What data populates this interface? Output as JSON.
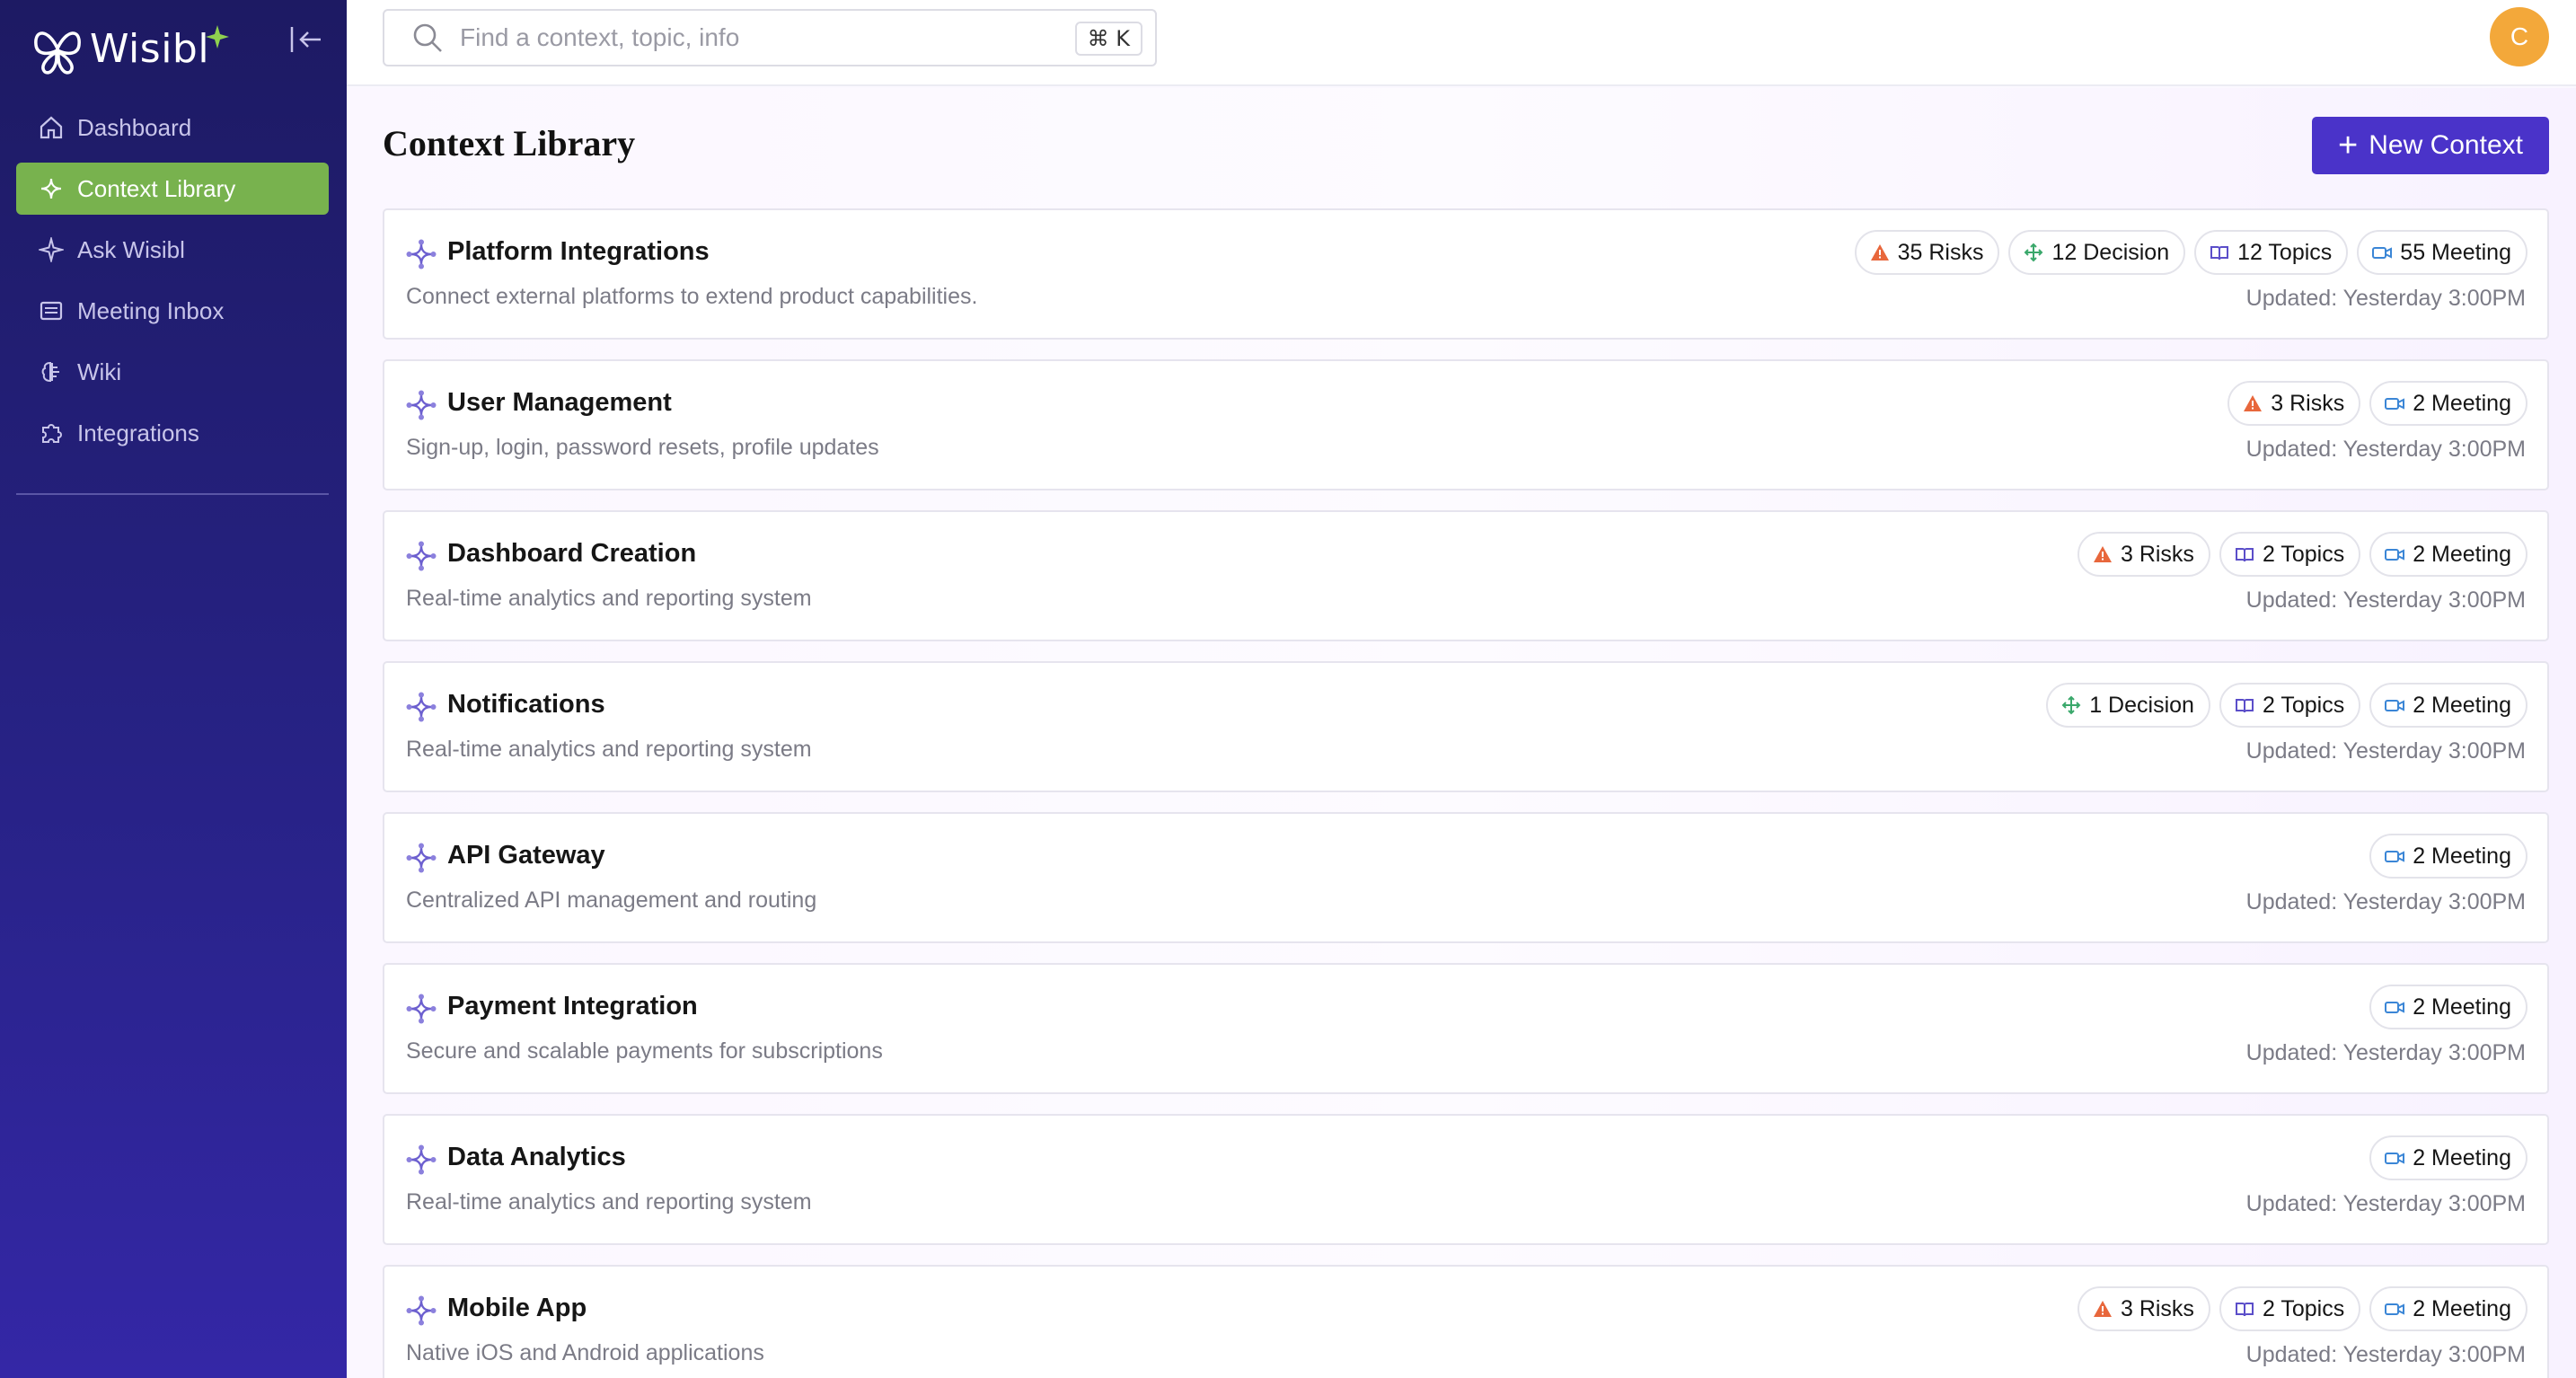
{
  "app": {
    "logo_text": "Wisibl"
  },
  "sidebar": {
    "items": [
      {
        "label": "Dashboard",
        "icon": "home-icon",
        "active": false
      },
      {
        "label": "Context Library",
        "icon": "sparkle-icon",
        "active": true
      },
      {
        "label": "Ask Wisibl",
        "icon": "star-icon",
        "active": false
      },
      {
        "label": "Meeting Inbox",
        "icon": "inbox-icon",
        "active": false
      },
      {
        "label": "Wiki",
        "icon": "brain-icon",
        "active": false
      },
      {
        "label": "Integrations",
        "icon": "puzzle-icon",
        "active": false
      }
    ]
  },
  "search": {
    "placeholder": "Find a context, topic, info",
    "shortcut": "⌘ K"
  },
  "user": {
    "avatar_initial": "C"
  },
  "page": {
    "title": "Context Library",
    "new_button": "New Context"
  },
  "colors": {
    "sidebar": "#272285",
    "active": "#78b24e",
    "primary": "#4a33c9",
    "risk": "#e8673c",
    "decision": "#3aa86b",
    "topic": "#5b4ec9",
    "meeting": "#3b86d6",
    "avatar": "#f3a83a"
  },
  "contexts": [
    {
      "title": "Platform Integrations",
      "description": "Connect external platforms to extend product capabilities.",
      "updated": "Updated: Yesterday 3:00PM",
      "badges": [
        {
          "type": "risk",
          "label": "35 Risks"
        },
        {
          "type": "decision",
          "label": "12 Decision"
        },
        {
          "type": "topic",
          "label": "12 Topics"
        },
        {
          "type": "meeting",
          "label": "55 Meeting"
        }
      ]
    },
    {
      "title": "User Management",
      "description": "Sign-up, login, password resets, profile updates",
      "updated": "Updated: Yesterday 3:00PM",
      "badges": [
        {
          "type": "risk",
          "label": "3 Risks"
        },
        {
          "type": "meeting",
          "label": "2 Meeting"
        }
      ]
    },
    {
      "title": "Dashboard Creation",
      "description": "Real-time analytics and reporting system",
      "updated": "Updated: Yesterday 3:00PM",
      "badges": [
        {
          "type": "risk",
          "label": "3 Risks"
        },
        {
          "type": "topic",
          "label": "2 Topics"
        },
        {
          "type": "meeting",
          "label": "2 Meeting"
        }
      ]
    },
    {
      "title": "Notifications",
      "description": "Real-time analytics and reporting system",
      "updated": "Updated: Yesterday 3:00PM",
      "badges": [
        {
          "type": "decision",
          "label": "1 Decision"
        },
        {
          "type": "topic",
          "label": "2 Topics"
        },
        {
          "type": "meeting",
          "label": "2 Meeting"
        }
      ]
    },
    {
      "title": "API Gateway",
      "description": "Centralized API management and routing",
      "updated": "Updated: Yesterday 3:00PM",
      "badges": [
        {
          "type": "meeting",
          "label": "2 Meeting"
        }
      ]
    },
    {
      "title": "Payment Integration",
      "description": "Secure and scalable payments for subscriptions",
      "updated": "Updated: Yesterday 3:00PM",
      "badges": [
        {
          "type": "meeting",
          "label": "2 Meeting"
        }
      ]
    },
    {
      "title": "Data Analytics",
      "description": "Real-time analytics and reporting system",
      "updated": "Updated: Yesterday 3:00PM",
      "badges": [
        {
          "type": "meeting",
          "label": "2 Meeting"
        }
      ]
    },
    {
      "title": "Mobile App",
      "description": "Native iOS and Android applications",
      "updated": "Updated: Yesterday 3:00PM",
      "badges": [
        {
          "type": "risk",
          "label": "3 Risks"
        },
        {
          "type": "topic",
          "label": "2 Topics"
        },
        {
          "type": "meeting",
          "label": "2 Meeting"
        }
      ]
    }
  ]
}
